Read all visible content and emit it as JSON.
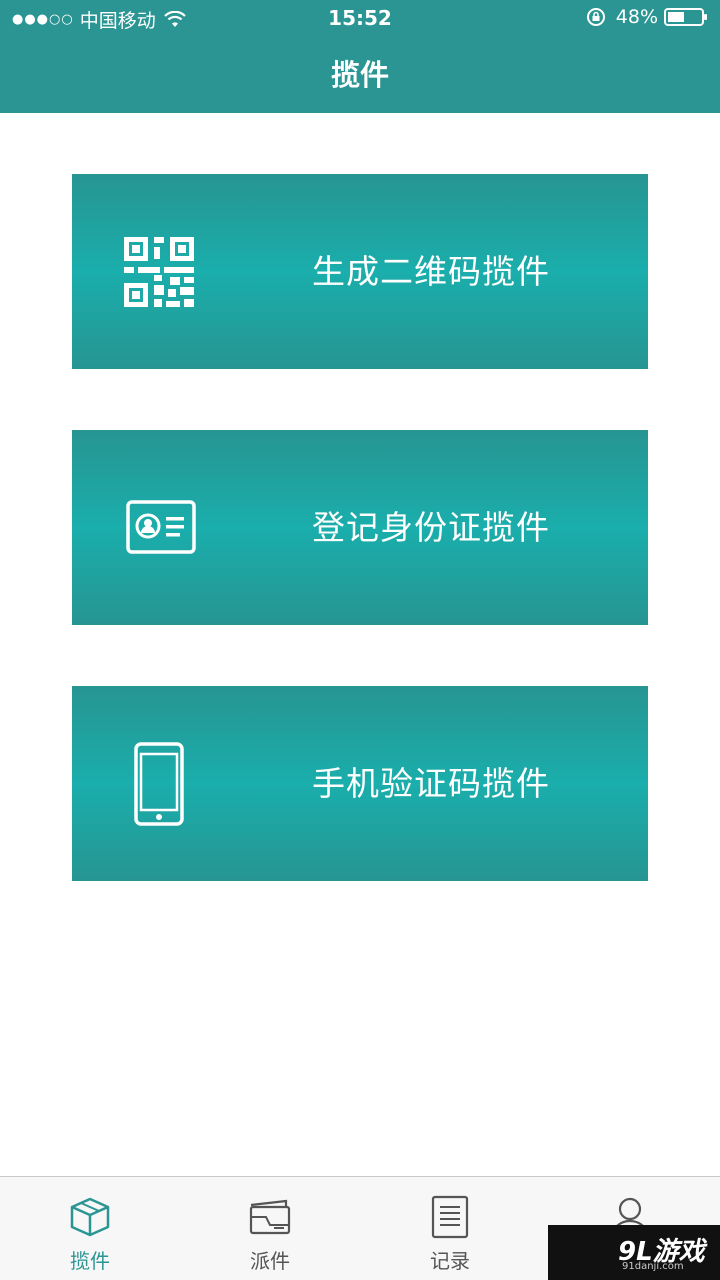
{
  "status_bar": {
    "signal": "●●●○○",
    "carrier": "中国移动",
    "time": "15:52",
    "battery": "48%"
  },
  "header": {
    "title": "揽件"
  },
  "options": [
    {
      "label": "生成二维码揽件",
      "icon": "qr-code-icon"
    },
    {
      "label": "登记身份证揽件",
      "icon": "id-card-icon"
    },
    {
      "label": "手机验证码揽件",
      "icon": "mobile-phone-icon"
    }
  ],
  "tabs": [
    {
      "label": "揽件",
      "icon": "package-box-icon",
      "active": true
    },
    {
      "label": "派件",
      "icon": "delivery-folder-icon",
      "active": false
    },
    {
      "label": "记录",
      "icon": "document-list-icon",
      "active": false
    },
    {
      "label": "",
      "icon": "user-profile-icon",
      "active": false
    }
  ],
  "watermark": {
    "main": "9L游戏",
    "sub": "91danji.com"
  },
  "colors": {
    "brand": "#2a9593",
    "card_mid": "#1aaeac",
    "tab_inactive": "#555555"
  }
}
